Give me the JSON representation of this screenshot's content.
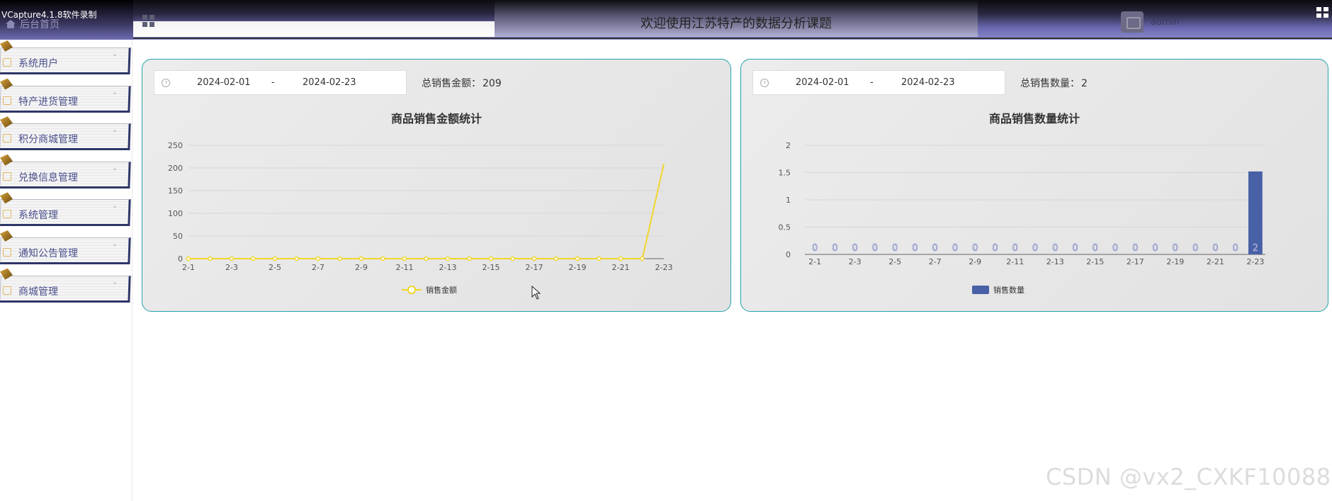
{
  "recorder_watermark": "VCapture4.1.8软件录制",
  "header": {
    "home_label": "后台首页",
    "title": "欢迎使用江苏特产的数据分析课题",
    "username": "admin"
  },
  "sidebar": {
    "items": [
      {
        "label": "系统用户",
        "icon": "user-icon"
      },
      {
        "label": "特产进货管理",
        "icon": "box-icon"
      },
      {
        "label": "积分商城管理",
        "icon": "box-icon"
      },
      {
        "label": "兑换信息管理",
        "icon": "box-icon"
      },
      {
        "label": "系统管理",
        "icon": "image-icon"
      },
      {
        "label": "通知公告管理",
        "icon": "info-icon"
      },
      {
        "label": "商城管理",
        "icon": "cart-icon"
      }
    ]
  },
  "panels": {
    "amount": {
      "start_date": "2024-02-01",
      "separator": "-",
      "end_date": "2024-02-23",
      "total_label": "总销售金额：",
      "total_value": "209"
    },
    "quantity": {
      "start_date": "2024-02-01",
      "separator": "-",
      "end_date": "2024-02-23",
      "total_label": "总销售数量：",
      "total_value": "2"
    }
  },
  "colors": {
    "line": "#f0d62a",
    "bar": "#4760a6",
    "panel_border": "#27a3a8"
  },
  "footer_watermark": "CSDN @vx2_CXKF10088",
  "chart_data": [
    {
      "type": "line",
      "title": "商品销售金额统计",
      "categories": [
        "2-1",
        "2-2",
        "2-3",
        "2-4",
        "2-5",
        "2-6",
        "2-7",
        "2-8",
        "2-9",
        "2-10",
        "2-11",
        "2-12",
        "2-13",
        "2-14",
        "2-15",
        "2-16",
        "2-17",
        "2-18",
        "2-19",
        "2-20",
        "2-21",
        "2-22",
        "2-23"
      ],
      "tick_labels": [
        "2-1",
        "2-3",
        "2-5",
        "2-7",
        "2-9",
        "2-11",
        "2-13",
        "2-15",
        "2-17",
        "2-19",
        "2-21",
        "2-23"
      ],
      "series": [
        {
          "name": "销售金额",
          "values": [
            0,
            0,
            0,
            0,
            0,
            0,
            0,
            0,
            0,
            0,
            0,
            0,
            0,
            0,
            0,
            0,
            0,
            0,
            0,
            0,
            0,
            0,
            209
          ]
        }
      ],
      "ylim": [
        0,
        250
      ],
      "yticks": [
        0,
        50,
        100,
        150,
        200,
        250
      ],
      "legend": "bottom-center",
      "grid": true
    },
    {
      "type": "bar",
      "title": "商品销售数量统计",
      "categories": [
        "2-1",
        "2-2",
        "2-3",
        "2-4",
        "2-5",
        "2-6",
        "2-7",
        "2-8",
        "2-9",
        "2-10",
        "2-11",
        "2-12",
        "2-13",
        "2-14",
        "2-15",
        "2-16",
        "2-17",
        "2-18",
        "2-19",
        "2-20",
        "2-21",
        "2-22",
        "2-23"
      ],
      "tick_labels": [
        "2-1",
        "2-3",
        "2-5",
        "2-7",
        "2-9",
        "2-11",
        "2-13",
        "2-15",
        "2-17",
        "2-19",
        "2-21",
        "2-23"
      ],
      "series": [
        {
          "name": "销售数量",
          "values": [
            0,
            0,
            0,
            0,
            0,
            0,
            0,
            0,
            0,
            0,
            0,
            0,
            0,
            0,
            0,
            0,
            0,
            0,
            0,
            0,
            0,
            0,
            2
          ]
        }
      ],
      "ylim": [
        0,
        2
      ],
      "yticks": [
        "0",
        "0.5",
        "1",
        "1.5",
        "2"
      ],
      "legend": "bottom-center",
      "data_labels": true,
      "grid": true
    }
  ]
}
